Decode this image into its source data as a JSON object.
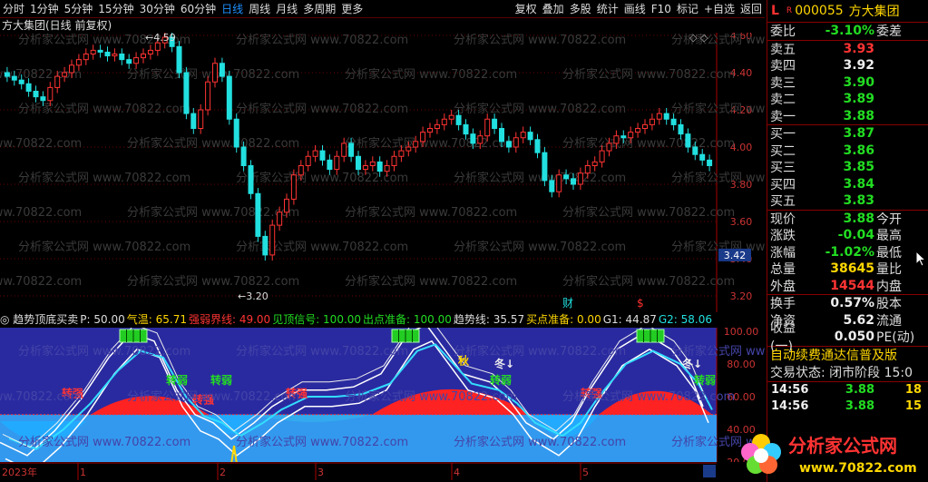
{
  "toolbar": {
    "items": [
      "分时",
      "1分钟",
      "5分钟",
      "15分钟",
      "30分钟",
      "60分钟",
      "日线",
      "周线",
      "月线",
      "多周期",
      "更多"
    ],
    "active_index": 6,
    "right_items": [
      "复权",
      "叠加",
      "多股",
      "统计",
      "画线",
      "F10",
      "标记",
      "+自选",
      "返回"
    ]
  },
  "chart": {
    "title": "方大集团(日线 前复权)",
    "watermark": "分析家公式网 www.70822.com",
    "y_ticks": [
      "4.60",
      "4.40",
      "4.20",
      "4.00",
      "3.80",
      "3.60",
      "3.40",
      "3.20"
    ],
    "current_price_tag": "3.42",
    "high_label": "4.59",
    "low_label": "3.20",
    "event_labels": [
      {
        "text": "财",
        "color": "#22e0e0"
      },
      {
        "text": "$",
        "color": "#ff3030"
      }
    ],
    "x_labels": [
      "2023年",
      "1",
      "2",
      "3",
      "4",
      "5"
    ],
    "colors": {
      "up": "#ff3333",
      "down": "#22e0e0",
      "grid": "#6a0000",
      "axis": "#aa0000"
    }
  },
  "indicator": {
    "name": "趋势顶底买卖",
    "params": [
      {
        "label": "P: 50.00",
        "color": "#dddddd"
      },
      {
        "label": "气温: 65.71",
        "color": "#ffd700"
      },
      {
        "label": "强弱界线: 49.00",
        "color": "#ff3333"
      },
      {
        "label": "见顶信号: 100.00",
        "color": "#22dd22"
      },
      {
        "label": "出点准备: 100.00",
        "color": "#22dd22"
      },
      {
        "label": "趋势线: 35.57",
        "color": "#dddddd"
      },
      {
        "label": "买点准备: 0.00",
        "color": "#ffd700"
      },
      {
        "label": "G1: 44.87",
        "color": "#dddddd"
      },
      {
        "label": "G2: 58.06",
        "color": "#22e0e0"
      }
    ],
    "y_ticks": [
      "100.00",
      "80.00",
      "60.00",
      "40.00",
      "20.00"
    ],
    "signals": [
      {
        "text": "转强",
        "color": "#ff3333"
      },
      {
        "text": "转弱",
        "color": "#22dd22"
      },
      {
        "text": "转强",
        "color": "#ff3333"
      },
      {
        "text": "转弱",
        "color": "#22dd22"
      },
      {
        "text": "转强",
        "color": "#ff3333"
      },
      {
        "text": "转弱",
        "color": "#22dd22"
      },
      {
        "text": "转强",
        "color": "#ff3333"
      },
      {
        "text": "转弱",
        "color": "#22dd22"
      },
      {
        "text": "秋",
        "color": "#ffd700"
      },
      {
        "text": "冬↓",
        "color": "#eeeeee"
      },
      {
        "text": "冬↓",
        "color": "#eeeeee"
      }
    ]
  },
  "panel": {
    "code": "000055",
    "name": "方大集团",
    "weibi_label": "委比",
    "weibi_value": "-3.10%",
    "weicha_label": "委差",
    "asks": [
      {
        "label": "卖五",
        "price": "3.93",
        "color": "#ff3333"
      },
      {
        "label": "卖四",
        "price": "3.92",
        "color": "#eeeeee"
      },
      {
        "label": "卖三",
        "price": "3.90",
        "color": "#22dd22"
      },
      {
        "label": "卖二",
        "price": "3.89",
        "color": "#22dd22"
      },
      {
        "label": "卖一",
        "price": "3.88",
        "color": "#22dd22"
      }
    ],
    "bids": [
      {
        "label": "买一",
        "price": "3.87",
        "color": "#22dd22"
      },
      {
        "label": "买二",
        "price": "3.86",
        "color": "#22dd22"
      },
      {
        "label": "买三",
        "price": "3.85",
        "color": "#22dd22"
      },
      {
        "label": "买四",
        "price": "3.84",
        "color": "#22dd22"
      },
      {
        "label": "买五",
        "price": "3.83",
        "color": "#22dd22"
      }
    ],
    "quote": [
      {
        "label": "现价",
        "value": "3.88",
        "color": "#22dd22",
        "label2": "今开"
      },
      {
        "label": "涨跌",
        "value": "-0.04",
        "color": "#22dd22",
        "label2": "最高"
      },
      {
        "label": "涨幅",
        "value": "-1.02%",
        "color": "#22dd22",
        "label2": "最低"
      },
      {
        "label": "总量",
        "value": "38645",
        "color": "#ffd700",
        "label2": "量比"
      },
      {
        "label": "外盘",
        "value": "14544",
        "color": "#ff3333",
        "label2": "内盘"
      }
    ],
    "quote2": [
      {
        "label": "换手",
        "value": "0.57%",
        "color": "#eeeeee",
        "label2": "股本"
      },
      {
        "label": "净资",
        "value": "5.62",
        "color": "#eeeeee",
        "label2": "流通"
      },
      {
        "label": "收益(一)",
        "value": "0.050",
        "color": "#eeeeee",
        "label2": "PE(动)"
      }
    ],
    "promo": "自动续费通达信普及版",
    "status": "交易状态: 闭市阶段 15:0",
    "ticks": [
      {
        "time": "14:56",
        "price": "3.88",
        "vol": "18"
      },
      {
        "time": "14:56",
        "price": "3.88",
        "vol": "15"
      }
    ],
    "R_label": "R",
    "L_label": "L"
  },
  "logo": {
    "text": "分析家公式网",
    "url_text": "www.70822.com"
  }
}
